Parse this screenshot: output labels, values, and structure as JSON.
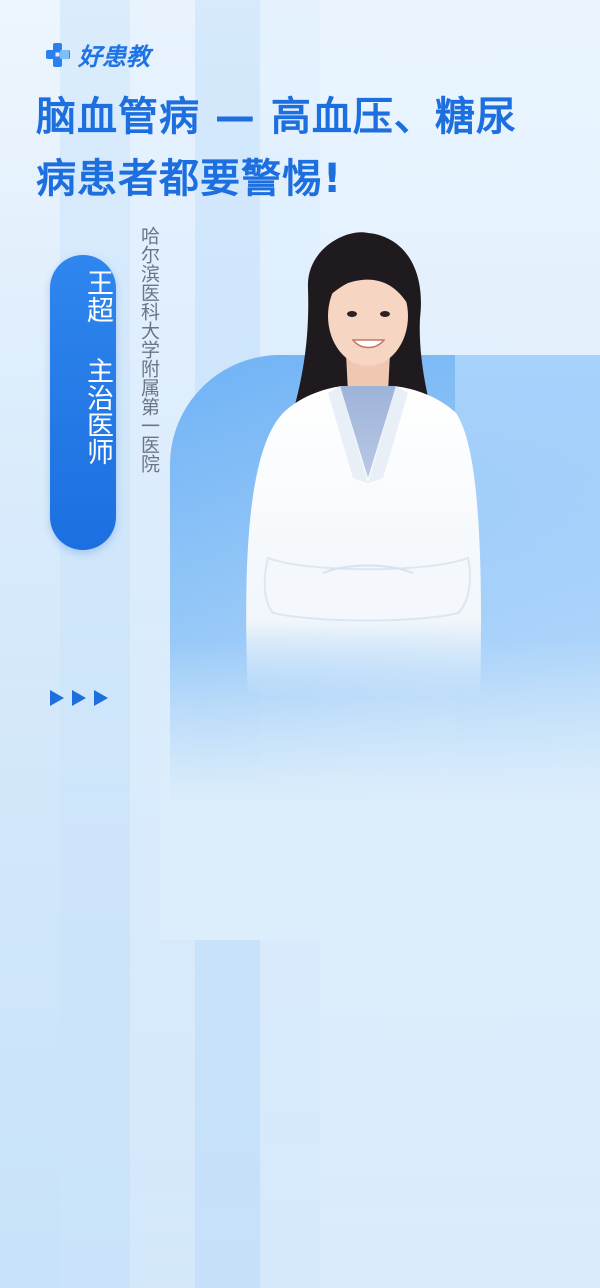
{
  "brand": {
    "logo_text": "好患教",
    "logo_icon": "medical-cross-logo-icon",
    "accent_color": "#1d6fe0"
  },
  "title": {
    "line1": "脑血管病 — 高血压、糖尿",
    "line2": "病患者都要警惕!"
  },
  "doctor": {
    "name": "王超",
    "role": "主治医师",
    "hospital": "哈尔滨医科大学附属第一医院",
    "photo": "doctor-portrait-image"
  },
  "decor": {
    "arrows_icon": "triple-play-arrows-icon"
  }
}
